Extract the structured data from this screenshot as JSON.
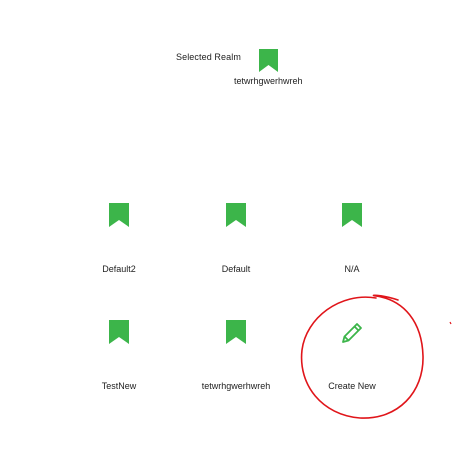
{
  "selected": {
    "label": "Selected Realm",
    "name": "tetwrhgwerhwreh",
    "icon": "bookmark-icon"
  },
  "realms": [
    {
      "name": "Default2",
      "icon": "bookmark-icon"
    },
    {
      "name": "Default",
      "icon": "bookmark-icon"
    },
    {
      "name": "N/A",
      "icon": "bookmark-icon"
    },
    {
      "name": "TestNew",
      "icon": "bookmark-icon"
    },
    {
      "name": "tetwrhgwerhwreh",
      "icon": "bookmark-icon"
    }
  ],
  "create": {
    "label": "Create New",
    "icon": "pencil-icon"
  },
  "colors": {
    "accent": "#3cb54a",
    "annotation": "#e0151a"
  }
}
